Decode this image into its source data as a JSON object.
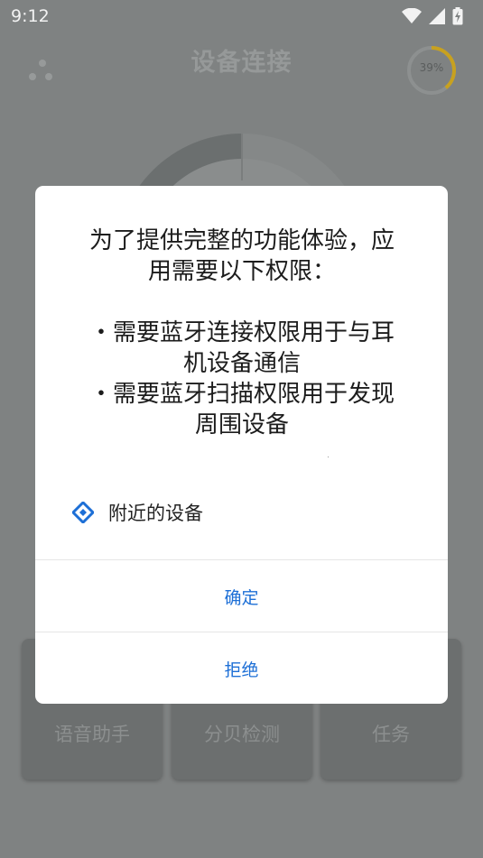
{
  "status_bar": {
    "time": "9:12",
    "icons": [
      "wifi-icon",
      "signal-icon",
      "battery-charging-icon"
    ]
  },
  "app": {
    "title": "设备连接",
    "battery_percent_label": "39%",
    "battery_level": 0.39,
    "battery_ring_color": "#c8a11f",
    "cards": [
      {
        "label": "语音助手",
        "icon": "microphone-icon"
      },
      {
        "label": "分贝检测",
        "icon": "decibel-icon"
      },
      {
        "label": "任务",
        "icon": "task-icon"
      }
    ]
  },
  "dialog": {
    "message_lines": [
      "为了提供完整的功能体验，应",
      "用需要以下权限：",
      "",
      "・需要蓝牙连接权限用于与耳",
      "机设备通信",
      "・需要蓝牙扫描权限用于发现",
      "周围设备"
    ],
    "permission": {
      "label": "附近的设备",
      "icon": "nearby-devices-icon",
      "icon_color": "#1d6fd6"
    },
    "confirm_label": "确定",
    "deny_label": "拒绝",
    "button_color": "#1d6fd6"
  }
}
